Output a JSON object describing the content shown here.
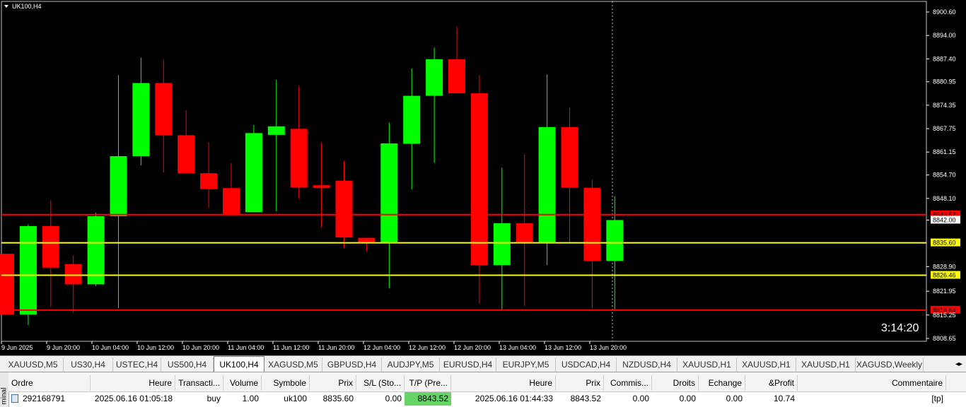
{
  "chart": {
    "title": "UK100,H4",
    "timer": "3:14:20",
    "colors": {
      "background": "#000000",
      "bull": "#00ff00",
      "bear": "#ff0000",
      "wick_bull": "#00ff00",
      "wick_bear": "#ff0000",
      "axis_text": "#ffffff",
      "red_line": "#ff0000",
      "yellow_line": "#ffff00"
    },
    "price_axis_ticks": [
      "8900.60",
      "8894.00",
      "8887.40",
      "8880.95",
      "8874.35",
      "8867.75",
      "8861.15",
      "8854.70",
      "8848.10",
      "8842.00",
      "8828.90",
      "8821.95",
      "8815.25",
      "8808.65"
    ],
    "time_axis_ticks": [
      "9 Jun 2025",
      "9 Jun 20:00",
      "10 Jun 04:00",
      "10 Jun 12:00",
      "10 Jun 20:00",
      "11 Jun 04:00",
      "11 Jun 12:00",
      "11 Jun 20:00",
      "12 Jun 04:00",
      "12 Jun 12:00",
      "12 Jun 20:00",
      "13 Jun 04:00",
      "13 Jun 12:00",
      "13 Jun 20:00"
    ],
    "horizontal_lines": [
      {
        "price": 8843.52,
        "label": "8843.52",
        "color": "#ff0000",
        "label_bg": "#ff0000",
        "label_fg": "#000000"
      },
      {
        "price": 8835.6,
        "label": "8835.60",
        "color": "#ffff00",
        "label_bg": "#ffff00",
        "label_fg": "#000000"
      },
      {
        "price": 8826.46,
        "label": "8826.46",
        "color": "#ffff00",
        "label_bg": "#ffff00",
        "label_fg": "#000000"
      },
      {
        "price": 8816.64,
        "label": "8816.64",
        "color": "#ff0000",
        "label_bg": "#ff0000",
        "label_fg": "#000000"
      },
      {
        "price": 8842.0,
        "label": "8842.00",
        "color": "none",
        "label_bg": "#ffffff",
        "label_fg": "#000000"
      }
    ],
    "candles": [
      {
        "o": 8832.5,
        "h": 8832.5,
        "l": 8815.4,
        "c": 8815.4
      },
      {
        "o": 8815.4,
        "h": 8840.8,
        "l": 8812.4,
        "c": 8840.3
      },
      {
        "o": 8840.3,
        "h": 8847.6,
        "l": 8817.5,
        "c": 8828.6
      },
      {
        "o": 8829.6,
        "h": 8832.0,
        "l": 8815.8,
        "c": 8823.9
      },
      {
        "o": 8823.9,
        "h": 8844.1,
        "l": 8823.4,
        "c": 8843.1
      },
      {
        "o": 8843.1,
        "h": 8882.8,
        "l": 8817.2,
        "c": 8860.0
      },
      {
        "o": 8860.0,
        "h": 8887.8,
        "l": 8857.4,
        "c": 8880.6
      },
      {
        "o": 8880.6,
        "h": 8887.2,
        "l": 8855.4,
        "c": 8865.9
      },
      {
        "o": 8865.9,
        "h": 8872.9,
        "l": 8855.5,
        "c": 8855.2
      },
      {
        "o": 8855.2,
        "h": 8864.0,
        "l": 8845.4,
        "c": 8850.7
      },
      {
        "o": 8851.0,
        "h": 8858.0,
        "l": 8844.2,
        "c": 8843.6
      },
      {
        "o": 8844.2,
        "h": 8868.8,
        "l": 8844.2,
        "c": 8866.5
      },
      {
        "o": 8866.0,
        "h": 8881.5,
        "l": 8844.5,
        "c": 8868.4
      },
      {
        "o": 8867.7,
        "h": 8879.8,
        "l": 8848.1,
        "c": 8851.2
      },
      {
        "o": 8851.8,
        "h": 8863.8,
        "l": 8839.9,
        "c": 8851.0
      },
      {
        "o": 8853.1,
        "h": 8858.6,
        "l": 8834.2,
        "c": 8837.1
      },
      {
        "o": 8837.0,
        "h": 8837.0,
        "l": 8833.3,
        "c": 8835.6
      },
      {
        "o": 8835.6,
        "h": 8869.5,
        "l": 8822.8,
        "c": 8863.6
      },
      {
        "o": 8863.5,
        "h": 8884.7,
        "l": 8850.6,
        "c": 8877.0
      },
      {
        "o": 8877.0,
        "h": 8890.6,
        "l": 8858.1,
        "c": 8887.3
      },
      {
        "o": 8887.3,
        "h": 8896.5,
        "l": 8878.8,
        "c": 8877.7
      },
      {
        "o": 8877.7,
        "h": 8882.8,
        "l": 8818.6,
        "c": 8829.3
      },
      {
        "o": 8829.3,
        "h": 8856.8,
        "l": 8816.8,
        "c": 8841.1
      },
      {
        "o": 8841.1,
        "h": 8860.4,
        "l": 8817.8,
        "c": 8835.6
      },
      {
        "o": 8835.6,
        "h": 8883.0,
        "l": 8829.3,
        "c": 8868.2
      },
      {
        "o": 8868.2,
        "h": 8873.6,
        "l": 8835.7,
        "c": 8851.1
      },
      {
        "o": 8851.1,
        "h": 8853.3,
        "l": 8817.1,
        "c": 8830.5
      },
      {
        "o": 8830.5,
        "h": 8848.7,
        "l": 8816.6,
        "c": 8842.0
      }
    ]
  },
  "tabs": [
    {
      "label": "XAUUSD,M5",
      "active": false
    },
    {
      "label": "US30,H4",
      "active": false
    },
    {
      "label": "USTEC,H4",
      "active": false
    },
    {
      "label": "US500,H4",
      "active": false
    },
    {
      "label": "UK100,H4",
      "active": true
    },
    {
      "label": "XAGUSD,M5",
      "active": false
    },
    {
      "label": "GBPUSD,H4",
      "active": false
    },
    {
      "label": "AUDJPY,M5",
      "active": false
    },
    {
      "label": "EURUSD,H4",
      "active": false
    },
    {
      "label": "EURJPY,M5",
      "active": false
    },
    {
      "label": "USDCAD,H4",
      "active": false
    },
    {
      "label": "NZDUSD,H4",
      "active": false
    },
    {
      "label": "XAUUSD,H1",
      "active": false
    },
    {
      "label": "XAUUSD,H1",
      "active": false
    },
    {
      "label": "XAUUSD,H1",
      "active": false
    },
    {
      "label": "XAGUSD,Weekly",
      "active": false
    }
  ],
  "tab_scroll_label": "◂▸",
  "terminal": {
    "side_label": "minal",
    "columns": [
      "Ordre",
      "Heure",
      "Transacti...",
      "Volume",
      "Symbole",
      "Prix",
      "S/L (Sto...",
      "T/P (Pre...",
      "Heure",
      "Prix",
      "Commis...",
      "Droits",
      "Echange",
      "&Profit",
      "Commentaire"
    ],
    "row": {
      "ordre": "292168791",
      "heure": "2025.06.16 01:05:18",
      "transaction": "buy",
      "volume": "1.00",
      "symbole": "uk100",
      "prix": "8835.60",
      "sl": "0.00",
      "tp": "8843.52",
      "heure_close": "2025.06.16 01:44:33",
      "prix_close": "8843.52",
      "commission": "0.00",
      "droits": "0.00",
      "echange": "0.00",
      "profit": "10.74",
      "commentaire": "[tp]"
    }
  }
}
